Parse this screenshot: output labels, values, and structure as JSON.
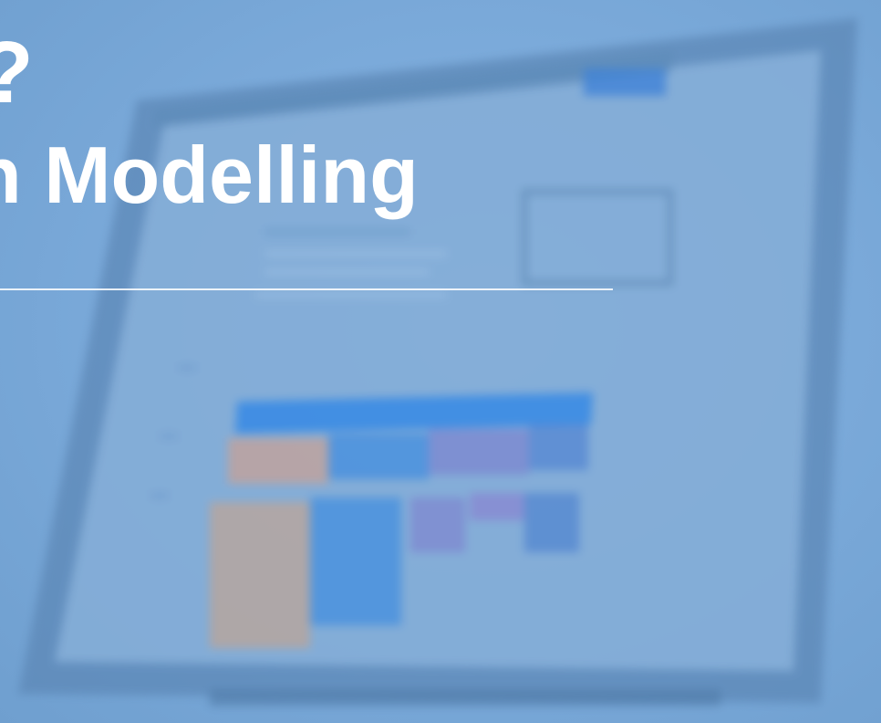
{
  "hero": {
    "title_line_1": "?",
    "title_line_2": "Modelling",
    "title_partial_prefix": "n"
  },
  "colors": {
    "background": "#7aa9d9",
    "text": "#ffffff"
  }
}
